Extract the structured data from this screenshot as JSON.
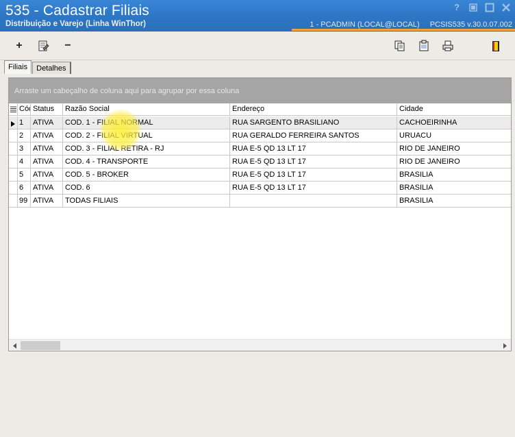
{
  "window": {
    "title": "535 - Cadastrar Filiais",
    "subtitle": "Distribuição e Varejo (Linha WinThor)",
    "user_info": "1 - PCADMIN (LOCAL@LOCAL)",
    "app_info": "PCSIS535  v.30.0.07.002",
    "help_label": "?"
  },
  "toolbar": {
    "add": "+",
    "remove": "−"
  },
  "tabs": [
    {
      "label": "Filiais",
      "active": true
    },
    {
      "label": "Detalhes",
      "active": false
    }
  ],
  "grid": {
    "group_hint": "Arraste um cabeçalho de coluna aqui para agrupar por essa coluna",
    "columns": {
      "cod": "Cód",
      "status": "Status",
      "razao": "Razão Social",
      "endereco": "Endereço",
      "cidade": "Cidade"
    },
    "rows": [
      {
        "cod": "1",
        "status": "ATIVA",
        "razao": "COD. 1 - FILIAL NORMAL",
        "endereco": "RUA SARGENTO BRASILIANO",
        "cidade": "CACHOEIRINHA",
        "selected": true
      },
      {
        "cod": "2",
        "status": "ATIVA",
        "razao": "COD. 2 - FILIAL VIRTUAL",
        "endereco": "RUA GERALDO FERREIRA SANTOS",
        "cidade": "URUACU"
      },
      {
        "cod": "3",
        "status": "ATIVA",
        "razao": "COD. 3 - FILIAL RETIRA - RJ",
        "endereco": "RUA E-5 QD 13 LT 17",
        "cidade": "RIO DE JANEIRO"
      },
      {
        "cod": "4",
        "status": "ATIVA",
        "razao": "COD. 4 - TRANSPORTE",
        "endereco": "RUA E-5 QD 13 LT 17",
        "cidade": "RIO DE JANEIRO"
      },
      {
        "cod": "5",
        "status": "ATIVA",
        "razao": "COD. 5 - BROKER",
        "endereco": "RUA E-5 QD 13 LT 17",
        "cidade": "BRASILIA"
      },
      {
        "cod": "6",
        "status": "ATIVA",
        "razao": "COD. 6",
        "endereco": "RUA E-5 QD 13 LT 17",
        "cidade": "BRASILIA"
      },
      {
        "cod": "99",
        "status": "ATIVA",
        "razao": "TODAS FILIAIS",
        "endereco": "",
        "cidade": "BRASILIA"
      }
    ]
  },
  "colors": {
    "titlebar": "#2d78c7",
    "accent_line": "#f0a33a",
    "group_bar": "#a5a5a5"
  }
}
